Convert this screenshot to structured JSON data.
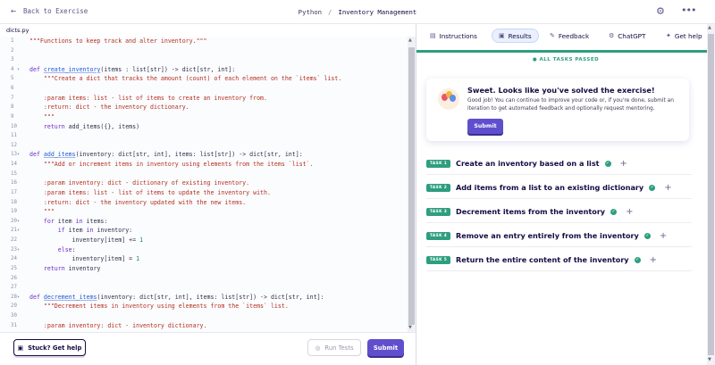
{
  "topbar": {
    "back_label": "Back to Exercise",
    "track": "Python",
    "separator": "/",
    "exercise": "Inventory Management"
  },
  "editor": {
    "filename": "dicts.py",
    "lines": [
      {
        "n": "1",
        "fold": "",
        "parts": [
          [
            "str",
            "\"\"\"Functions to keep track and alter inventory.\"\"\""
          ]
        ]
      },
      {
        "n": "2",
        "fold": "",
        "parts": []
      },
      {
        "n": "3",
        "fold": "",
        "parts": []
      },
      {
        "n": "4",
        "fold": "▾",
        "parts": [
          [
            "kw",
            "def "
          ],
          [
            "fn",
            "create_inventory"
          ],
          [
            "tx",
            "(items : list[str]) -> dict[str, int]:"
          ]
        ]
      },
      {
        "n": "5",
        "fold": "",
        "parts": [
          [
            "str",
            "    \"\"\"Create a dict that tracks the amount (count) of each element on the `items` list."
          ]
        ]
      },
      {
        "n": "6",
        "fold": "",
        "parts": []
      },
      {
        "n": "7",
        "fold": "",
        "parts": [
          [
            "str",
            "    :param items: list - list of items to create an inventory from."
          ]
        ]
      },
      {
        "n": "8",
        "fold": "",
        "parts": [
          [
            "str",
            "    :return: dict - the inventory dictionary."
          ]
        ]
      },
      {
        "n": "9",
        "fold": "",
        "parts": [
          [
            "str",
            "    \"\"\""
          ]
        ]
      },
      {
        "n": "10",
        "fold": "",
        "parts": [
          [
            "kw",
            "    return "
          ],
          [
            "tx",
            "add_items({}, items)"
          ]
        ]
      },
      {
        "n": "11",
        "fold": "",
        "parts": []
      },
      {
        "n": "12",
        "fold": "",
        "parts": []
      },
      {
        "n": "13",
        "fold": "▾",
        "parts": [
          [
            "kw",
            "def "
          ],
          [
            "fn",
            "add_items"
          ],
          [
            "tx",
            "(inventory: dict[str, int], items: list[str]) -> dict[str, int]:"
          ]
        ]
      },
      {
        "n": "14",
        "fold": "",
        "parts": [
          [
            "str",
            "    \"\"\"Add or increment items in inventory using elements from the items `list`."
          ]
        ]
      },
      {
        "n": "15",
        "fold": "",
        "parts": []
      },
      {
        "n": "16",
        "fold": "",
        "parts": [
          [
            "str",
            "    :param inventory: dict - dictionary of existing inventory."
          ]
        ]
      },
      {
        "n": "17",
        "fold": "",
        "parts": [
          [
            "str",
            "    :param items: list - list of items to update the inventory with."
          ]
        ]
      },
      {
        "n": "18",
        "fold": "",
        "parts": [
          [
            "str",
            "    :return: dict - the inventory updated with the new items."
          ]
        ]
      },
      {
        "n": "19",
        "fold": "",
        "parts": [
          [
            "str",
            "    \"\"\""
          ]
        ]
      },
      {
        "n": "20",
        "fold": "▾",
        "parts": [
          [
            "kw",
            "    for "
          ],
          [
            "tx",
            "item "
          ],
          [
            "kw",
            "in "
          ],
          [
            "tx",
            "items:"
          ]
        ]
      },
      {
        "n": "21",
        "fold": "▾",
        "parts": [
          [
            "kw",
            "        if "
          ],
          [
            "tx",
            "item "
          ],
          [
            "kw",
            "in "
          ],
          [
            "tx",
            "inventory:"
          ]
        ]
      },
      {
        "n": "22",
        "fold": "",
        "parts": [
          [
            "tx",
            "            inventory[item] += "
          ],
          [
            "num",
            "1"
          ]
        ]
      },
      {
        "n": "23",
        "fold": "▾",
        "parts": [
          [
            "kw",
            "        else"
          ],
          [
            "tx",
            ":"
          ]
        ]
      },
      {
        "n": "24",
        "fold": "",
        "parts": [
          [
            "tx",
            "            inventory[item] = "
          ],
          [
            "num",
            "1"
          ]
        ]
      },
      {
        "n": "25",
        "fold": "",
        "parts": [
          [
            "kw",
            "    return "
          ],
          [
            "tx",
            "inventory"
          ]
        ]
      },
      {
        "n": "26",
        "fold": "",
        "parts": []
      },
      {
        "n": "27",
        "fold": "",
        "parts": []
      },
      {
        "n": "28",
        "fold": "▾",
        "parts": [
          [
            "kw",
            "def "
          ],
          [
            "fn",
            "decrement_items"
          ],
          [
            "tx",
            "(inventory: dict[str, int], items: list[str]) -> dict[str, int]:"
          ]
        ]
      },
      {
        "n": "29",
        "fold": "",
        "parts": [
          [
            "str",
            "    \"\"\"Decrement items in inventory using elements from the `items` list."
          ]
        ]
      },
      {
        "n": "30",
        "fold": "",
        "parts": []
      },
      {
        "n": "31",
        "fold": "",
        "parts": [
          [
            "str",
            "    :param inventory: dict - inventory dictionary."
          ]
        ]
      }
    ]
  },
  "footer": {
    "help_label": "Stuck? Get help",
    "run_label": "Run Tests",
    "submit_label": "Submit"
  },
  "panel": {
    "tabs": [
      {
        "label": "Instructions",
        "icon": "book-icon",
        "glyph": "▤"
      },
      {
        "label": "Results",
        "icon": "results-icon",
        "glyph": "▣"
      },
      {
        "label": "Feedback",
        "icon": "chat-icon",
        "glyph": "✎"
      },
      {
        "label": "ChatGPT",
        "icon": "robot-icon",
        "glyph": "⚙"
      },
      {
        "label": "Get help",
        "icon": "bulb-icon",
        "glyph": "✦"
      }
    ],
    "passed_label": "● ALL TASKS PASSED",
    "card": {
      "title": "Sweet. Looks like you've solved the exercise!",
      "text": "Good job! You can continue to improve your code or, if you're done, submit an iteration to get automated feedback and optionally request mentoring.",
      "submit_label": "Submit"
    },
    "tasks": [
      {
        "badge": "TASK 1",
        "title": "Create an inventory based on a list"
      },
      {
        "badge": "TASK 2",
        "title": "Add items from a list to an existing dictionary"
      },
      {
        "badge": "TASK 3",
        "title": "Decrement items from the inventory"
      },
      {
        "badge": "TASK 4",
        "title": "Remove an entry entirely from the inventory"
      },
      {
        "badge": "TASK 5",
        "title": "Return the entire content of the inventory"
      }
    ]
  },
  "colors": {
    "accent": "#604fcd",
    "success": "#2e9e7e",
    "text": "#130b43"
  }
}
